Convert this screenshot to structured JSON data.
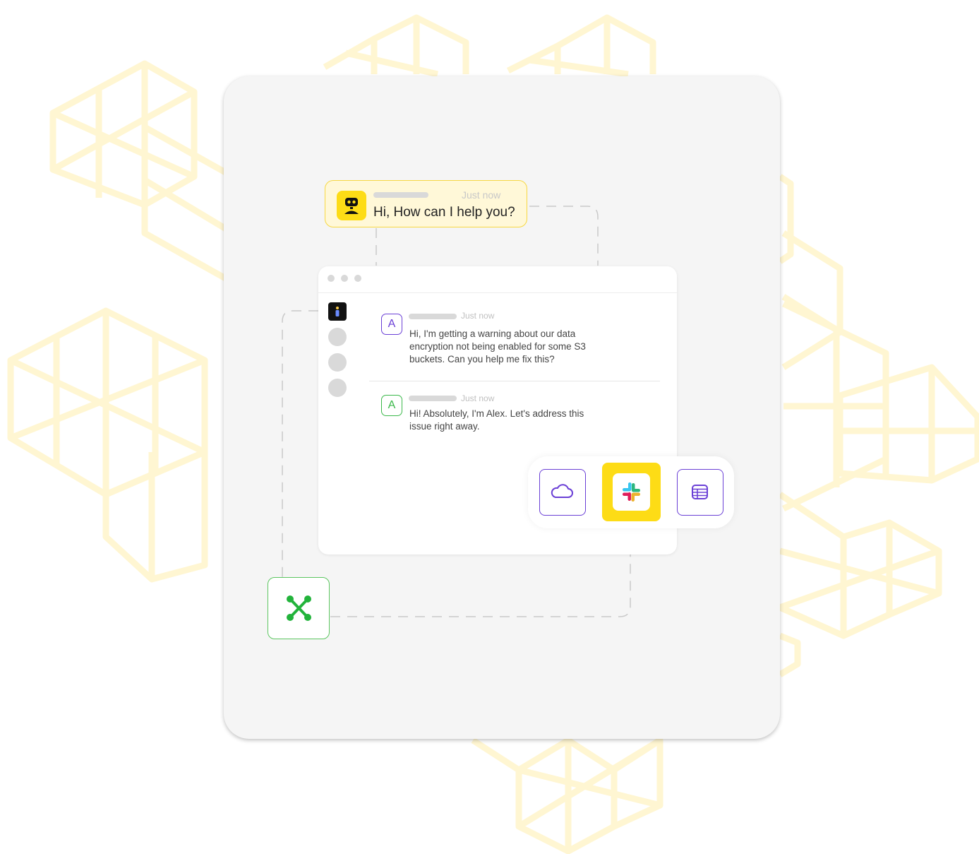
{
  "bot_bubble": {
    "time": "Just now",
    "message": "Hi, How can I help you?"
  },
  "chat": {
    "messages": [
      {
        "avatar_letter": "A",
        "time": "Just now",
        "text": "Hi, I'm getting a warning about our data encryption not being enabled for some S3 buckets. Can you help me fix this?"
      },
      {
        "avatar_letter": "A",
        "time": "Just now",
        "text": "Hi! Absolutely, I'm Alex. Let's address this issue right away."
      }
    ]
  },
  "integrations": [
    {
      "icon": "cloud-icon",
      "selected": false
    },
    {
      "icon": "slack-icon",
      "selected": true
    },
    {
      "icon": "table-icon",
      "selected": false
    }
  ],
  "colors": {
    "accent_yellow": "#fddc16",
    "bubble_bg": "#fff8d8",
    "user_purple": "#6a3fd6",
    "agent_green": "#3bb84a",
    "card_bg": "#f5f5f5"
  }
}
